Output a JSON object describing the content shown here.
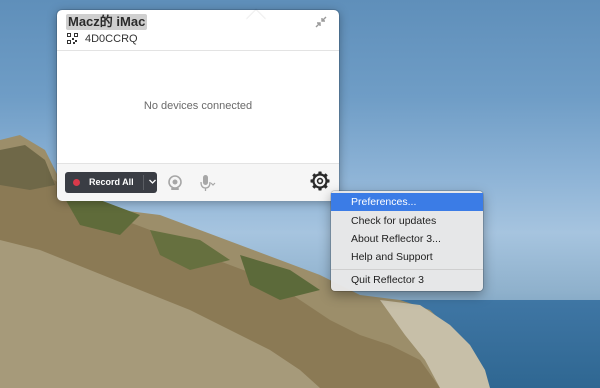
{
  "panel": {
    "host_name": "Macz的 iMac",
    "connection_code": "4D0CCRQ",
    "status_text": "No devices connected",
    "record_label": "Record All"
  },
  "menu": {
    "items": [
      {
        "label": "Preferences...",
        "selected": true
      },
      {
        "label": "Check for updates",
        "selected": false
      },
      {
        "label": "About Reflector 3...",
        "selected": false
      },
      {
        "label": "Help and Support",
        "selected": false
      },
      {
        "label": "Quit Reflector 3",
        "selected": false
      }
    ]
  },
  "icons": {
    "qr": "qr-code-icon",
    "collapse": "collapse-arrows-icon",
    "record_dot": "record-dot-icon",
    "caret": "chevron-down-icon",
    "camera": "camera-icon",
    "mic": "microphone-icon",
    "gear": "gear-icon"
  },
  "colors": {
    "record_button": "#3a3d44",
    "record_dot": "#d9394a",
    "menu_highlight": "#3b7ce6"
  }
}
